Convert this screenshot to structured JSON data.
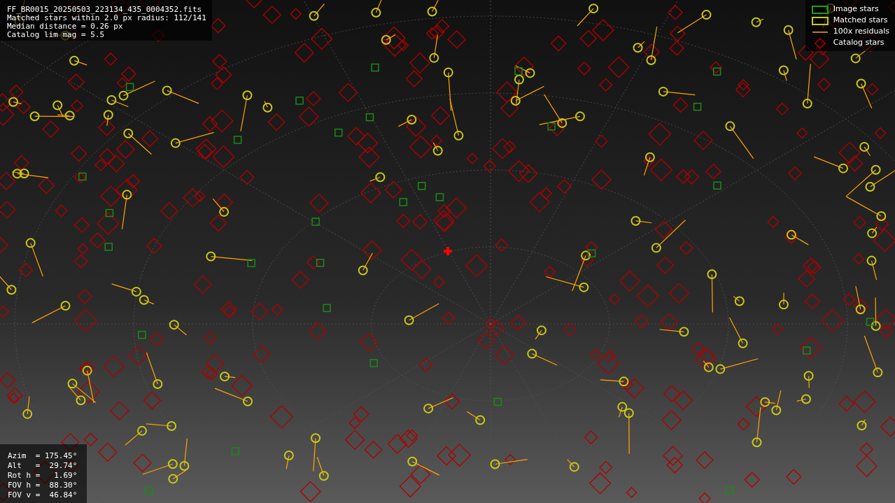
{
  "info_lines": [
    "FF_BR0015_20250503_223134_435_0004352.fits",
    "Matched stars within 2.0 px radius: 112/141",
    "Median distance = 0.26 px",
    "Catalog lim mag = 5.5"
  ],
  "legend": [
    {
      "kind": "image",
      "label": "Image stars"
    },
    {
      "kind": "matched",
      "label": "Matched stars"
    },
    {
      "kind": "residual",
      "label": "100x residuals"
    },
    {
      "kind": "catalog",
      "label": "Catalog stars"
    }
  ],
  "pointing_lines": [
    "Azim  = 175.45°",
    "Alt   =  29.74°",
    "Rot h =   1.69°",
    "FOV h =  88.30°",
    "FOV v =  46.84°"
  ]
}
